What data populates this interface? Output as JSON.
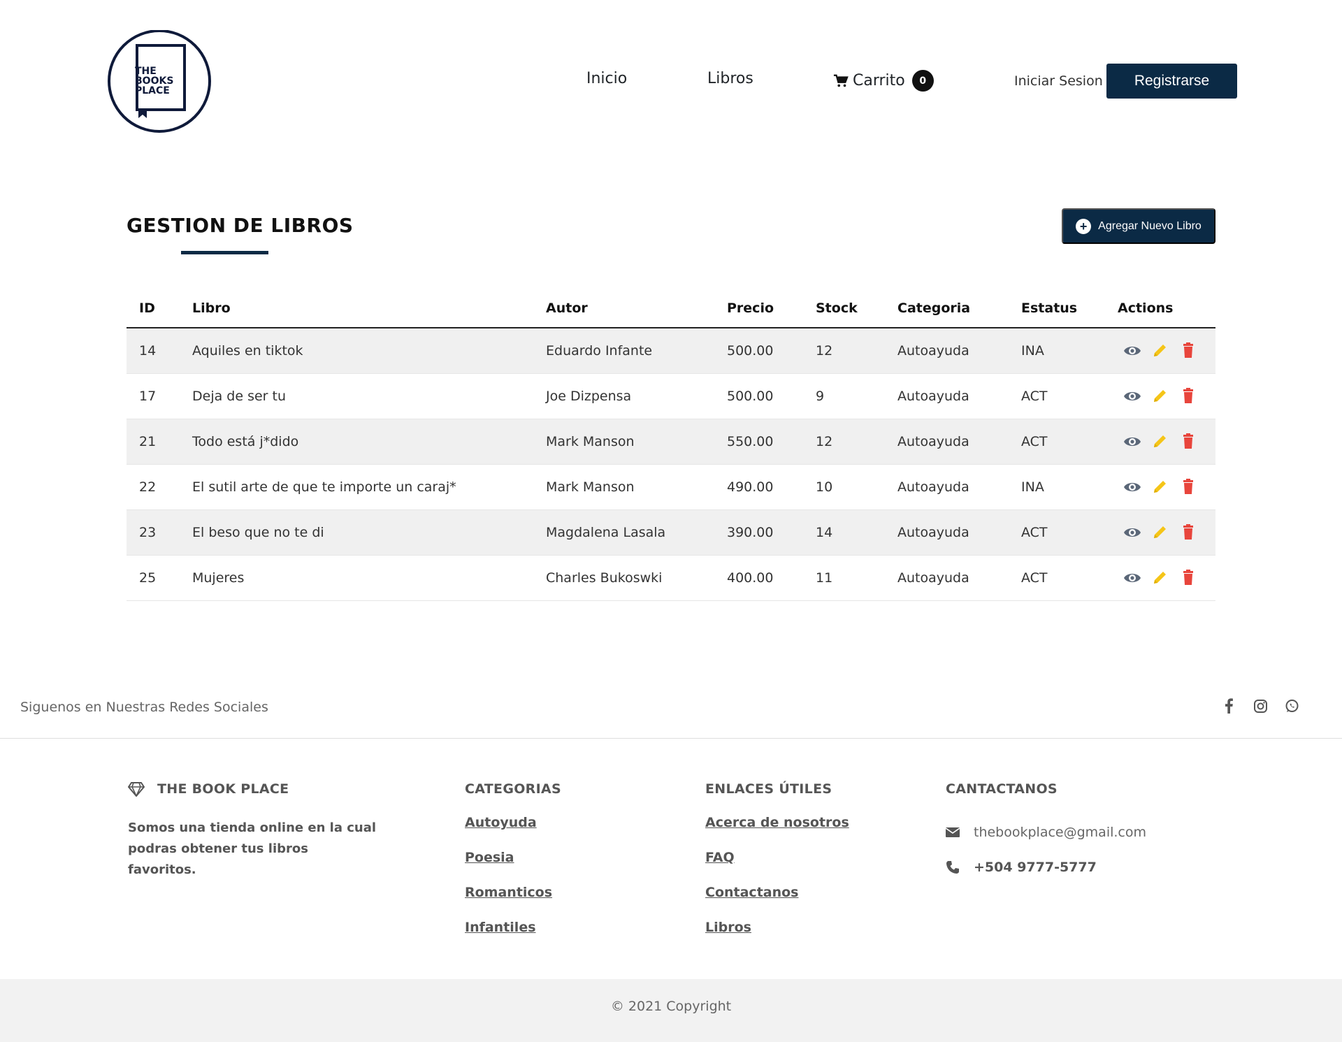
{
  "header": {
    "logo_text": "THE BOOKS PLACE",
    "nav": {
      "inicio": "Inicio",
      "libros": "Libros",
      "carrito": "Carrito",
      "cart_count": "0"
    },
    "login": "Iniciar Sesion",
    "register": "Registrarse"
  },
  "page": {
    "title_light": "GESTION DE ",
    "title_bold": "LIBROS",
    "add_button": "Agregar Nuevo Libro"
  },
  "table": {
    "headers": [
      "ID",
      "Libro",
      "Autor",
      "Precio",
      "Stock",
      "Categoria",
      "Estatus",
      "Actions"
    ],
    "rows": [
      {
        "id": "14",
        "libro": "Aquiles en tiktok",
        "autor": "Eduardo Infante",
        "precio": "500.00",
        "stock": "12",
        "categoria": "Autoayuda",
        "estatus": "INA"
      },
      {
        "id": "17",
        "libro": "Deja de ser tu",
        "autor": "Joe Dizpensa",
        "precio": "500.00",
        "stock": "9",
        "categoria": "Autoayuda",
        "estatus": "ACT"
      },
      {
        "id": "21",
        "libro": "Todo está j*dido",
        "autor": "Mark Manson",
        "precio": "550.00",
        "stock": "12",
        "categoria": "Autoayuda",
        "estatus": "ACT"
      },
      {
        "id": "22",
        "libro": "El sutil arte de que te importe un caraj*",
        "autor": "Mark Manson",
        "precio": "490.00",
        "stock": "10",
        "categoria": "Autoayuda",
        "estatus": "INA"
      },
      {
        "id": "23",
        "libro": "El beso que no te di",
        "autor": "Magdalena Lasala",
        "precio": "390.00",
        "stock": "14",
        "categoria": "Autoayuda",
        "estatus": "ACT"
      },
      {
        "id": "25",
        "libro": "Mujeres",
        "autor": "Charles Bukoswki",
        "precio": "400.00",
        "stock": "11",
        "categoria": "Autoayuda",
        "estatus": "ACT"
      }
    ],
    "action_icons": [
      "eye-icon",
      "pencil-icon",
      "trash-icon"
    ]
  },
  "social": {
    "text": "Siguenos en Nuestras Redes Sociales",
    "icons": [
      "facebook-icon",
      "instagram-icon",
      "whatsapp-icon"
    ]
  },
  "footer": {
    "brand": {
      "heading": "THE BOOK PLACE",
      "description": "Somos una tienda online en la cual podras obtener tus libros favoritos."
    },
    "categories": {
      "heading": "CATEGORIAS",
      "items": [
        "Autoyuda",
        "Poesia",
        "Romanticos",
        "Infantiles"
      ]
    },
    "links": {
      "heading": "ENLACES ÚTILES",
      "items": [
        "Acerca de nosotros",
        "FAQ",
        "Contactanos",
        "Libros"
      ]
    },
    "contact": {
      "heading": "CANTACTANOS",
      "email": "thebookplace@gmail.com",
      "phone": "+504 9777-5777"
    },
    "copyright": "© 2021 Copyright"
  },
  "colors": {
    "primary": "#0b2a45",
    "eye": "#5b6778",
    "pencil": "#f5c518",
    "trash": "#e8453c",
    "stripe": "#f0f0f0"
  }
}
